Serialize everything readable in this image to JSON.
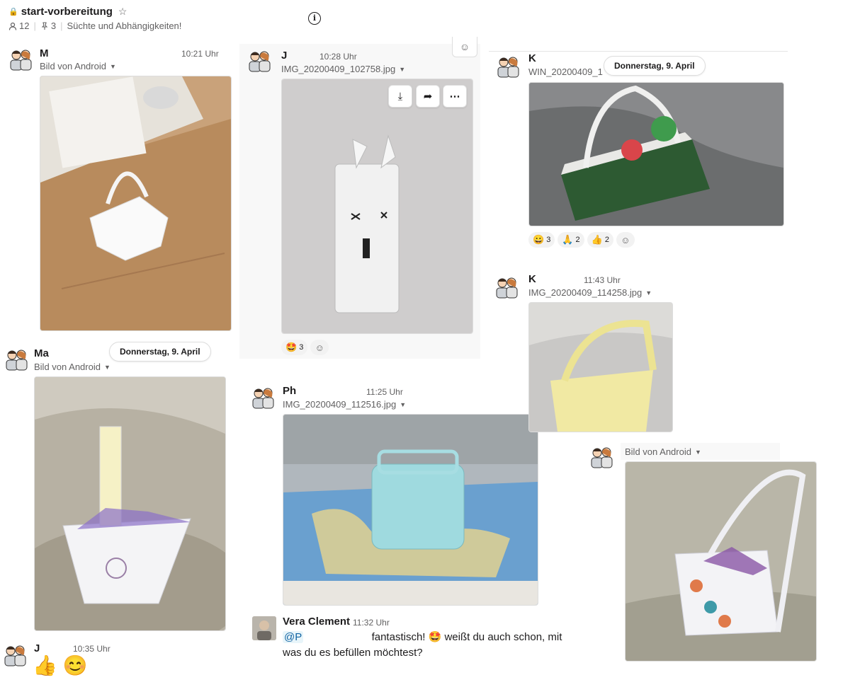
{
  "header": {
    "channel": "start-vorbereitung",
    "members": "12",
    "pins": "3",
    "topic": "Süchte und Abhängigkeiten!"
  },
  "date_pill": "Donnerstag, 9. April",
  "messages": [
    {
      "sender": "M",
      "time": "10:21 Uhr",
      "file": "Bild von Android"
    },
    {
      "sender": "Ma",
      "file": "Bild von Android"
    },
    {
      "sender": "J",
      "time": "10:35 Uhr",
      "emojis": "👍 😊"
    },
    {
      "sender": "J",
      "time": "10:28 Uhr",
      "file": "IMG_20200409_102758.jpg",
      "reaction_emoji": "🤩",
      "reaction_count": "3"
    },
    {
      "sender": "Ph",
      "time": "11:25 Uhr",
      "file": "IMG_20200409_112516.jpg"
    },
    {
      "sender": "Vera Clement",
      "time": "11:32 Uhr",
      "mention": "@P",
      "text1": "fantastisch! 🤩 weißt du auch schon, mit",
      "text2": "was du es befüllen möchtest?"
    },
    {
      "sender": "K",
      "file": "WIN_20200409_1"
    },
    {
      "sender": "K",
      "time": "11:43 Uhr",
      "file": "IMG_20200409_114258.jpg"
    },
    {
      "file": "Bild von Android"
    }
  ],
  "reactions_k": [
    {
      "emoji": "😀",
      "count": "3"
    },
    {
      "emoji": "🙏",
      "count": "2"
    },
    {
      "emoji": "👍",
      "count": "2"
    }
  ],
  "icons": {
    "lock": "🔒",
    "star": "☆",
    "info": "i",
    "person": "👤",
    "pin": "📌",
    "download": "⤓",
    "share": "➦",
    "more": "⋯",
    "caret": "▼",
    "add_reaction": "☺"
  }
}
